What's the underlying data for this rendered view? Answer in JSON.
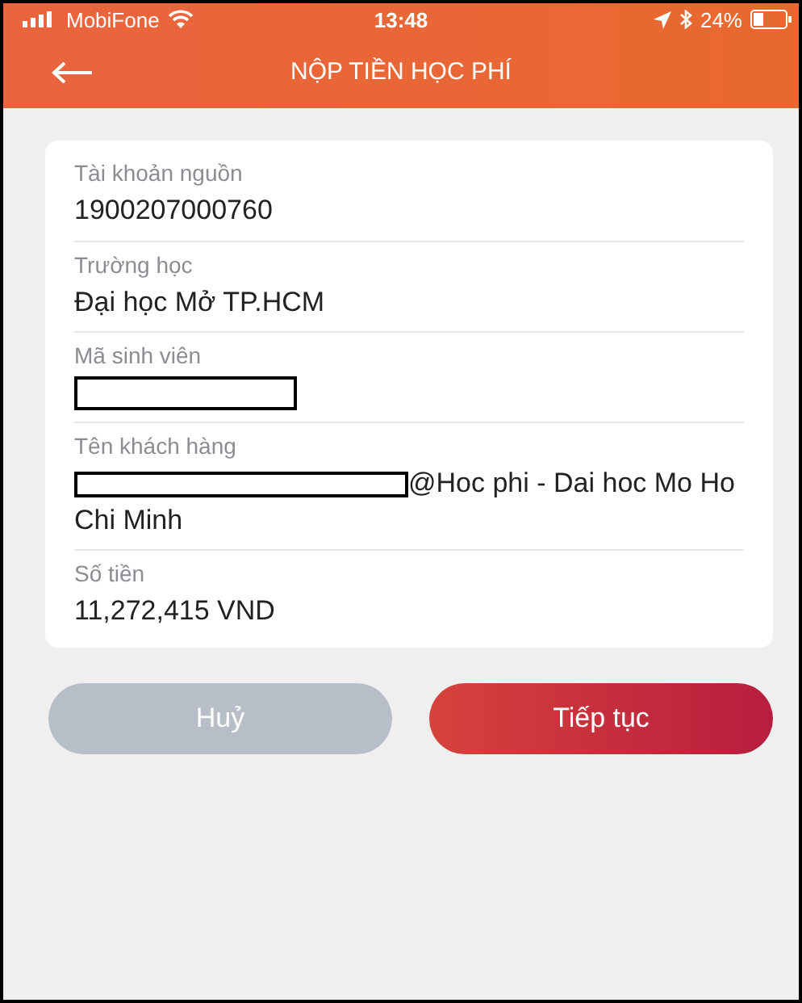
{
  "status_bar": {
    "carrier": "MobiFone",
    "time": "13:48",
    "battery": "24%"
  },
  "header": {
    "title": "NỘP TIỀN HỌC PHÍ"
  },
  "fields": [
    {
      "label": "Tài khoản nguồn",
      "value": "1900207000760",
      "redacted": false
    },
    {
      "label": "Trường học",
      "value": "Đại học Mở TP.HCM",
      "redacted": false
    },
    {
      "label": "Mã sinh viên",
      "redacted": true
    },
    {
      "label": "Tên khách hàng",
      "value": "@Hoc phi - Dai hoc Mo Ho Chi Minh",
      "redacted": true
    },
    {
      "label": "Số tiền",
      "value": "11,272,415 VND",
      "redacted": false
    }
  ],
  "buttons": [
    {
      "label": "Huỷ",
      "kind": "secondary"
    },
    {
      "label": "Tiếp tục",
      "kind": "primary"
    }
  ]
}
